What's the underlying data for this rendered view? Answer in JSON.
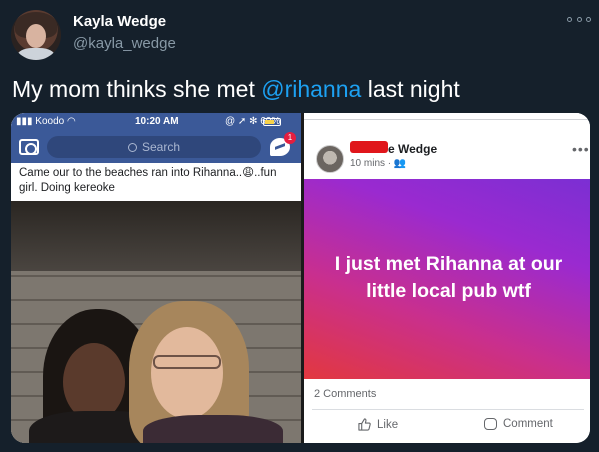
{
  "tweet": {
    "display_name": "Kayla Wedge",
    "handle": "@kayla_wedge",
    "text_before": "My mom thinks she met ",
    "mention": "@rihanna",
    "text_after": " last night"
  },
  "left_screenshot": {
    "carrier": "Koodo",
    "time": "10:20 AM",
    "battery": "60%",
    "search_placeholder": "Search",
    "notification_count": "1",
    "caption": "Came our to the beaches ran into Rihanna..😩..fun girl. Doing kereoke"
  },
  "right_screenshot": {
    "poster_name_visible": "e Wedge",
    "post_time": "10 mins · 👥",
    "post_text": "I just met Rihanna at our little local pub wtf",
    "comments_count": "2 Comments",
    "like_label": "Like",
    "comment_label": "Comment"
  },
  "colors": {
    "background": "#15202b",
    "mention": "#1da1f2",
    "facebook_blue": "#3b5998",
    "post_gradient_start": "#7b2fd3",
    "post_gradient_end": "#e2383f"
  }
}
